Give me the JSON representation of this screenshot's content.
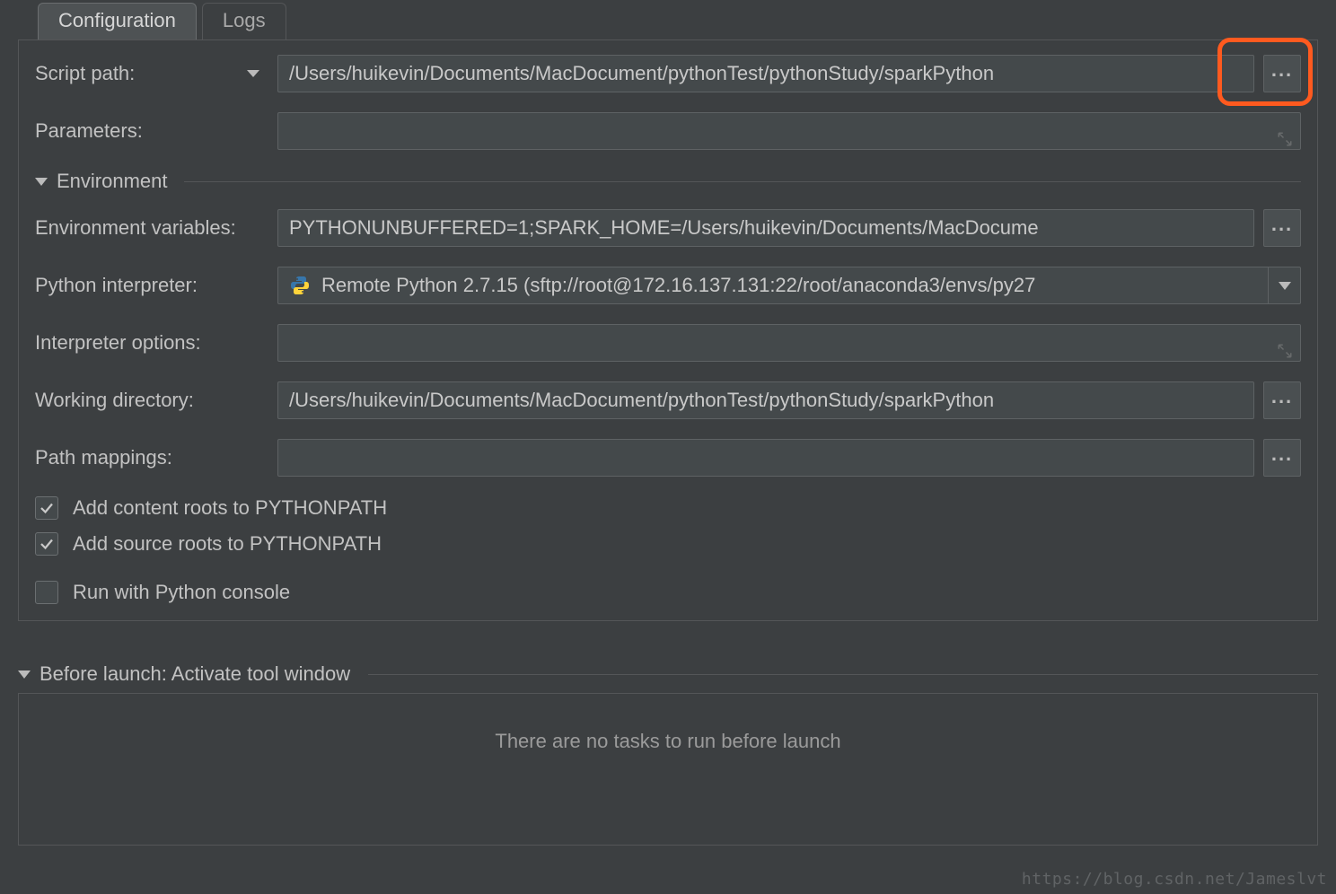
{
  "tabs": {
    "configuration": "Configuration",
    "logs": "Logs"
  },
  "labels": {
    "script_path": "Script path:",
    "parameters": "Parameters:",
    "environment": "Environment",
    "env_vars": "Environment variables:",
    "py_interp": "Python interpreter:",
    "interp_opts": "Interpreter options:",
    "work_dir": "Working directory:",
    "path_map": "Path mappings:",
    "cb_content": "Add content roots to PYTHONPATH",
    "cb_source": "Add source roots to PYTHONPATH",
    "cb_console": "Run with Python console",
    "before_launch": "Before launch: Activate tool window",
    "no_tasks": "There are no tasks to run before launch"
  },
  "values": {
    "script_path": "/Users/huikevin/Documents/MacDocument/pythonTest/pythonStudy/sparkPython",
    "parameters": "",
    "env_vars": "PYTHONUNBUFFERED=1;SPARK_HOME=/Users/huikevin/Documents/MacDocume",
    "py_interp": "Remote Python 2.7.15 (sftp://root@172.16.137.131:22/root/anaconda3/envs/py27",
    "interp_opts": "",
    "work_dir": "/Users/huikevin/Documents/MacDocument/pythonTest/pythonStudy/sparkPython",
    "path_map": ""
  },
  "checkboxes": {
    "content": true,
    "source": true,
    "console": false
  },
  "watermark": "https://blog.csdn.net/Jameslvt"
}
